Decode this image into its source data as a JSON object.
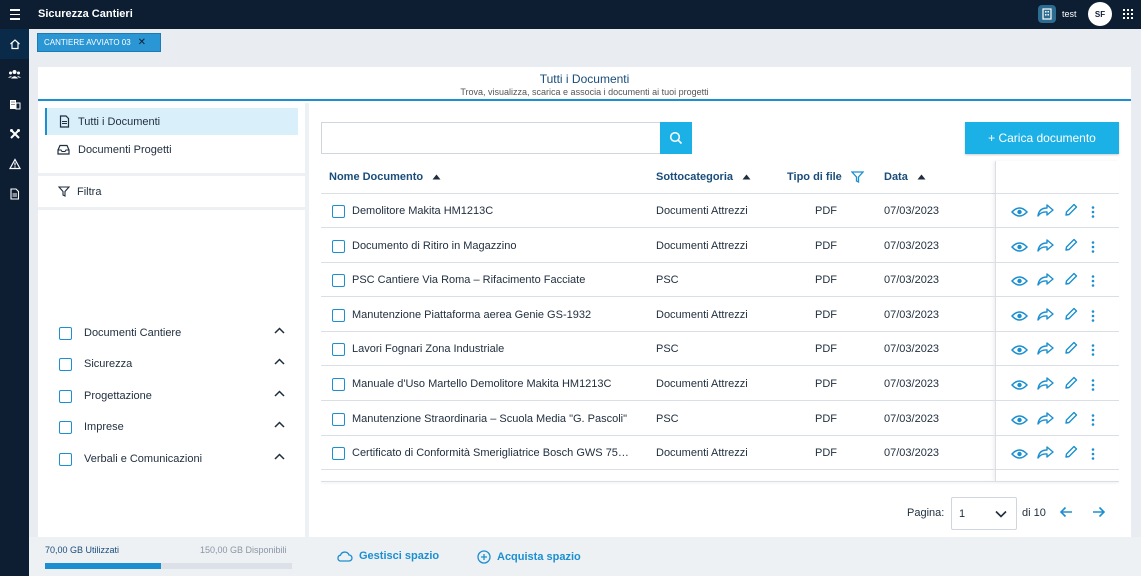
{
  "app": {
    "title": "Sicurezza Cantieri",
    "user": "test",
    "initials": "SF"
  },
  "chip": {
    "label": "CANTIERE AVVIATO 03",
    "close": "✕"
  },
  "header": {
    "title": "Tutti i Documenti",
    "subtitle": "Trova, visualizza, scarica e associa i documenti ai tuoi progetti"
  },
  "sidebar": {
    "items": [
      {
        "label": "Tutti i Documenti"
      },
      {
        "label": "Documenti Progetti"
      }
    ],
    "filter": "Filtra",
    "categories": [
      {
        "label": "Documenti Cantiere"
      },
      {
        "label": "Sicurezza"
      },
      {
        "label": "Progettazione"
      },
      {
        "label": "Imprese"
      },
      {
        "label": "Verbali e Comunicazioni"
      }
    ]
  },
  "search": {
    "placeholder": ""
  },
  "toolbar": {
    "upload_label": "+ Carica documento"
  },
  "table": {
    "columns": [
      "Nome Documento",
      "Sottocategoria",
      "Tipo di file",
      "Data"
    ],
    "rows": [
      {
        "name": "Demolitore Makita HM1213C",
        "sub": "Documenti Attrezzi",
        "type": "PDF",
        "date": "07/03/2023"
      },
      {
        "name": "Documento di Ritiro in Magazzino",
        "sub": "Documenti Attrezzi",
        "type": "PDF",
        "date": "07/03/2023"
      },
      {
        "name": "PSC Cantiere Via Roma – Rifacimento Facciate",
        "sub": "PSC",
        "type": "PDF",
        "date": "07/03/2023"
      },
      {
        "name": "Manutenzione Piattaforma aerea Genie GS-1932",
        "sub": "Documenti Attrezzi",
        "type": "PDF",
        "date": "07/03/2023"
      },
      {
        "name": "Lavori Fognari Zona Industriale",
        "sub": "PSC",
        "type": "PDF",
        "date": "07/03/2023"
      },
      {
        "name": "Manuale d'Uso Martello Demolitore Makita HM1213C",
        "sub": "Documenti Attrezzi",
        "type": "PDF",
        "date": "07/03/2023"
      },
      {
        "name": "Manutenzione Straordinaria – Scuola Media \"G. Pascoli\"",
        "sub": "PSC",
        "type": "PDF",
        "date": "07/03/2023"
      },
      {
        "name": "Certificato di Conformità Smerigliatrice Bosch GWS 75…",
        "sub": "Documenti Attrezzi",
        "type": "PDF",
        "date": "07/03/2023"
      }
    ]
  },
  "pagination": {
    "label": "Pagina:",
    "current": "1",
    "total_label": "di 10"
  },
  "storage": {
    "used": "70,00 GB Utilizzati",
    "available": "150,00 GB Disponibili",
    "used_fraction": 0.47
  },
  "footer": {
    "manage": "Gestisci spazio",
    "buy": "Acquista spazio"
  },
  "colors": {
    "accent": "#1b8fd0",
    "button": "#1bb1e6",
    "navy": "#0d1e33"
  }
}
